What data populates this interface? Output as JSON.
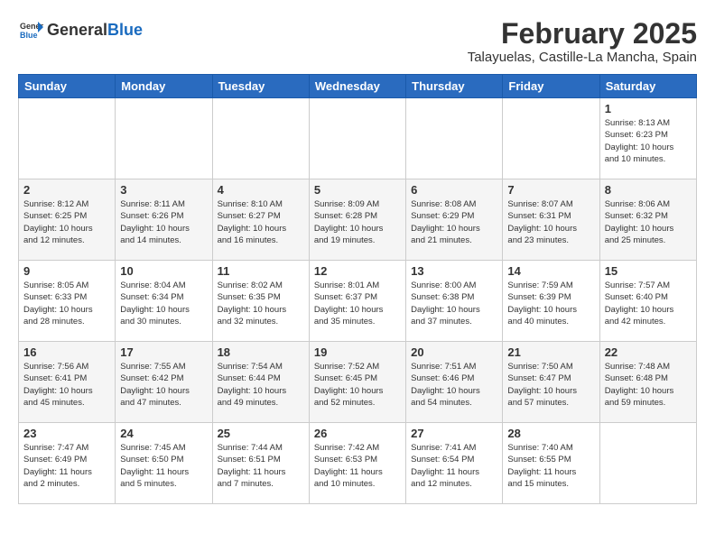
{
  "logo": {
    "general": "General",
    "blue": "Blue"
  },
  "header": {
    "month": "February 2025",
    "location": "Talayuelas, Castille-La Mancha, Spain"
  },
  "days": [
    "Sunday",
    "Monday",
    "Tuesday",
    "Wednesday",
    "Thursday",
    "Friday",
    "Saturday"
  ],
  "weeks": [
    [
      {
        "day": "",
        "text": ""
      },
      {
        "day": "",
        "text": ""
      },
      {
        "day": "",
        "text": ""
      },
      {
        "day": "",
        "text": ""
      },
      {
        "day": "",
        "text": ""
      },
      {
        "day": "",
        "text": ""
      },
      {
        "day": "1",
        "text": "Sunrise: 8:13 AM\nSunset: 6:23 PM\nDaylight: 10 hours\nand 10 minutes."
      }
    ],
    [
      {
        "day": "2",
        "text": "Sunrise: 8:12 AM\nSunset: 6:25 PM\nDaylight: 10 hours\nand 12 minutes."
      },
      {
        "day": "3",
        "text": "Sunrise: 8:11 AM\nSunset: 6:26 PM\nDaylight: 10 hours\nand 14 minutes."
      },
      {
        "day": "4",
        "text": "Sunrise: 8:10 AM\nSunset: 6:27 PM\nDaylight: 10 hours\nand 16 minutes."
      },
      {
        "day": "5",
        "text": "Sunrise: 8:09 AM\nSunset: 6:28 PM\nDaylight: 10 hours\nand 19 minutes."
      },
      {
        "day": "6",
        "text": "Sunrise: 8:08 AM\nSunset: 6:29 PM\nDaylight: 10 hours\nand 21 minutes."
      },
      {
        "day": "7",
        "text": "Sunrise: 8:07 AM\nSunset: 6:31 PM\nDaylight: 10 hours\nand 23 minutes."
      },
      {
        "day": "8",
        "text": "Sunrise: 8:06 AM\nSunset: 6:32 PM\nDaylight: 10 hours\nand 25 minutes."
      }
    ],
    [
      {
        "day": "9",
        "text": "Sunrise: 8:05 AM\nSunset: 6:33 PM\nDaylight: 10 hours\nand 28 minutes."
      },
      {
        "day": "10",
        "text": "Sunrise: 8:04 AM\nSunset: 6:34 PM\nDaylight: 10 hours\nand 30 minutes."
      },
      {
        "day": "11",
        "text": "Sunrise: 8:02 AM\nSunset: 6:35 PM\nDaylight: 10 hours\nand 32 minutes."
      },
      {
        "day": "12",
        "text": "Sunrise: 8:01 AM\nSunset: 6:37 PM\nDaylight: 10 hours\nand 35 minutes."
      },
      {
        "day": "13",
        "text": "Sunrise: 8:00 AM\nSunset: 6:38 PM\nDaylight: 10 hours\nand 37 minutes."
      },
      {
        "day": "14",
        "text": "Sunrise: 7:59 AM\nSunset: 6:39 PM\nDaylight: 10 hours\nand 40 minutes."
      },
      {
        "day": "15",
        "text": "Sunrise: 7:57 AM\nSunset: 6:40 PM\nDaylight: 10 hours\nand 42 minutes."
      }
    ],
    [
      {
        "day": "16",
        "text": "Sunrise: 7:56 AM\nSunset: 6:41 PM\nDaylight: 10 hours\nand 45 minutes."
      },
      {
        "day": "17",
        "text": "Sunrise: 7:55 AM\nSunset: 6:42 PM\nDaylight: 10 hours\nand 47 minutes."
      },
      {
        "day": "18",
        "text": "Sunrise: 7:54 AM\nSunset: 6:44 PM\nDaylight: 10 hours\nand 49 minutes."
      },
      {
        "day": "19",
        "text": "Sunrise: 7:52 AM\nSunset: 6:45 PM\nDaylight: 10 hours\nand 52 minutes."
      },
      {
        "day": "20",
        "text": "Sunrise: 7:51 AM\nSunset: 6:46 PM\nDaylight: 10 hours\nand 54 minutes."
      },
      {
        "day": "21",
        "text": "Sunrise: 7:50 AM\nSunset: 6:47 PM\nDaylight: 10 hours\nand 57 minutes."
      },
      {
        "day": "22",
        "text": "Sunrise: 7:48 AM\nSunset: 6:48 PM\nDaylight: 10 hours\nand 59 minutes."
      }
    ],
    [
      {
        "day": "23",
        "text": "Sunrise: 7:47 AM\nSunset: 6:49 PM\nDaylight: 11 hours\nand 2 minutes."
      },
      {
        "day": "24",
        "text": "Sunrise: 7:45 AM\nSunset: 6:50 PM\nDaylight: 11 hours\nand 5 minutes."
      },
      {
        "day": "25",
        "text": "Sunrise: 7:44 AM\nSunset: 6:51 PM\nDaylight: 11 hours\nand 7 minutes."
      },
      {
        "day": "26",
        "text": "Sunrise: 7:42 AM\nSunset: 6:53 PM\nDaylight: 11 hours\nand 10 minutes."
      },
      {
        "day": "27",
        "text": "Sunrise: 7:41 AM\nSunset: 6:54 PM\nDaylight: 11 hours\nand 12 minutes."
      },
      {
        "day": "28",
        "text": "Sunrise: 7:40 AM\nSunset: 6:55 PM\nDaylight: 11 hours\nand 15 minutes."
      },
      {
        "day": "",
        "text": ""
      }
    ]
  ]
}
